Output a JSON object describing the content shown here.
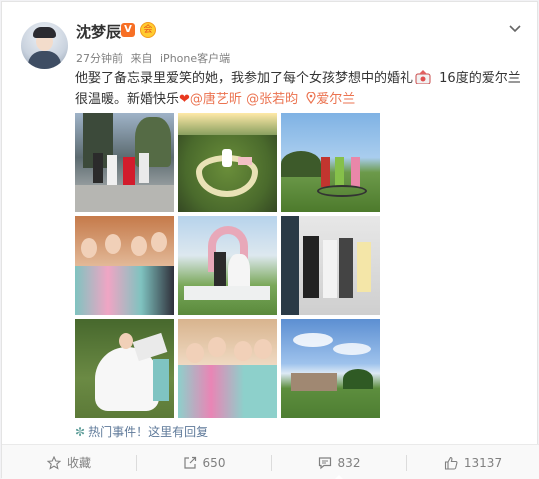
{
  "post": {
    "username": "沈梦辰",
    "verified_badge": "V",
    "crown_label": "会",
    "time": "27分钟前",
    "source_prefix": "来自",
    "source": "iPhone客户端",
    "text_part1": "他娶了备忘录里爱笑的她，我参加了每个女孩梦想中的婚礼",
    "text_part2": " 16度的爱尔兰很温暖。新婚快乐",
    "heart": "❤",
    "mention1": "@唐艺昕",
    "mention2": "@张若昀",
    "location": "爱尔兰",
    "hot_icon": "✼",
    "hot_text": "热门事件！这里有回复"
  },
  "actions": {
    "favorite_label": "收藏",
    "repost_count": "650",
    "comment_count": "832",
    "like_count": "13137"
  },
  "photos": [
    {
      "name": "photo-1"
    },
    {
      "name": "photo-2"
    },
    {
      "name": "photo-3"
    },
    {
      "name": "photo-4"
    },
    {
      "name": "photo-5"
    },
    {
      "name": "photo-6"
    },
    {
      "name": "photo-7"
    },
    {
      "name": "photo-8"
    },
    {
      "name": "photo-9"
    }
  ],
  "colors": {
    "link": "#eb7350",
    "username": "#333333",
    "meta": "#808080",
    "verified": "#f76f25"
  }
}
